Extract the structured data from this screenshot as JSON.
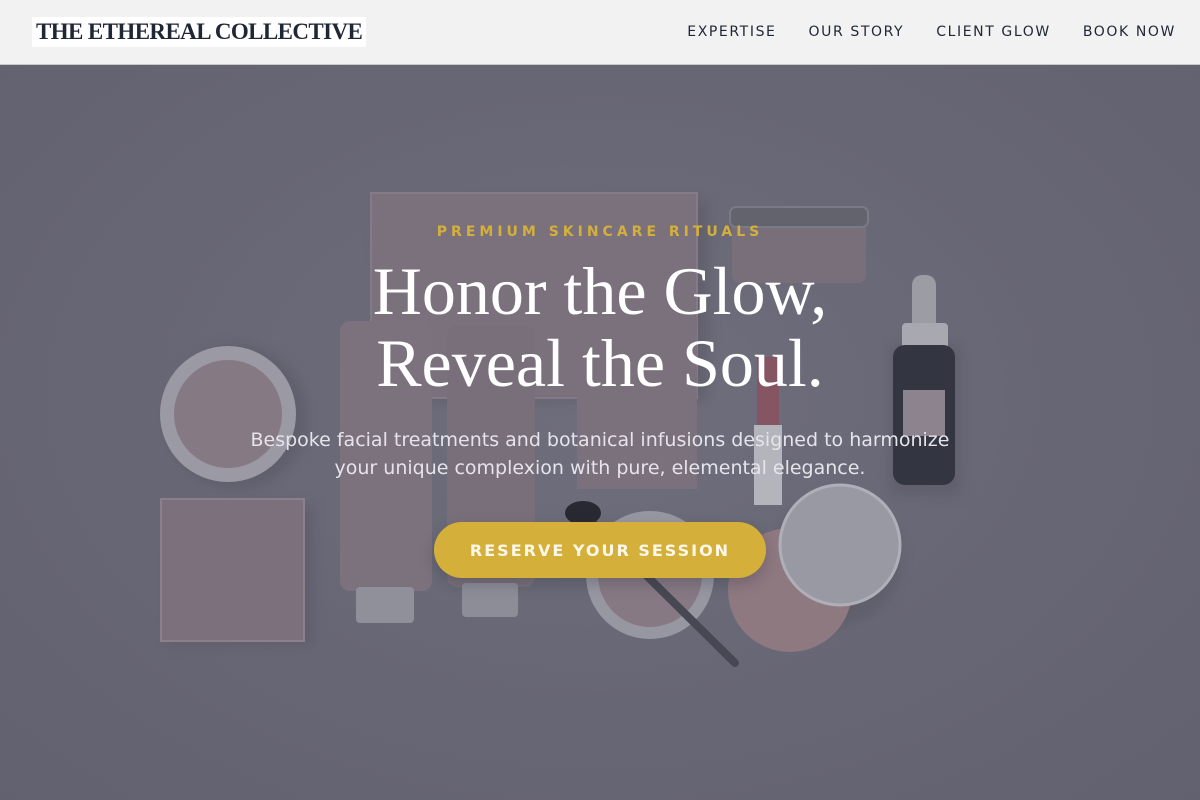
{
  "header": {
    "logo": "THE ETHEREAL COLLECTIVE",
    "nav": [
      {
        "label": "EXPERTISE"
      },
      {
        "label": "OUR STORY"
      },
      {
        "label": "CLIENT GLOW"
      },
      {
        "label": "BOOK NOW"
      }
    ]
  },
  "hero": {
    "eyebrow": "PREMIUM SKINCARE RITUALS",
    "headline_line1": "Honor the Glow,",
    "headline_line2": "Reveal the Soul.",
    "subtext": "Bespoke facial treatments and botanical infusions designed to harmonize your unique complexion with pure, elemental elegance.",
    "cta_label": "RESERVE YOUR SESSION"
  },
  "colors": {
    "accent": "#d4b03a",
    "header_bg": "#f2f2f2",
    "text_dark": "#1f2636",
    "hero_bg": "#73737f"
  }
}
